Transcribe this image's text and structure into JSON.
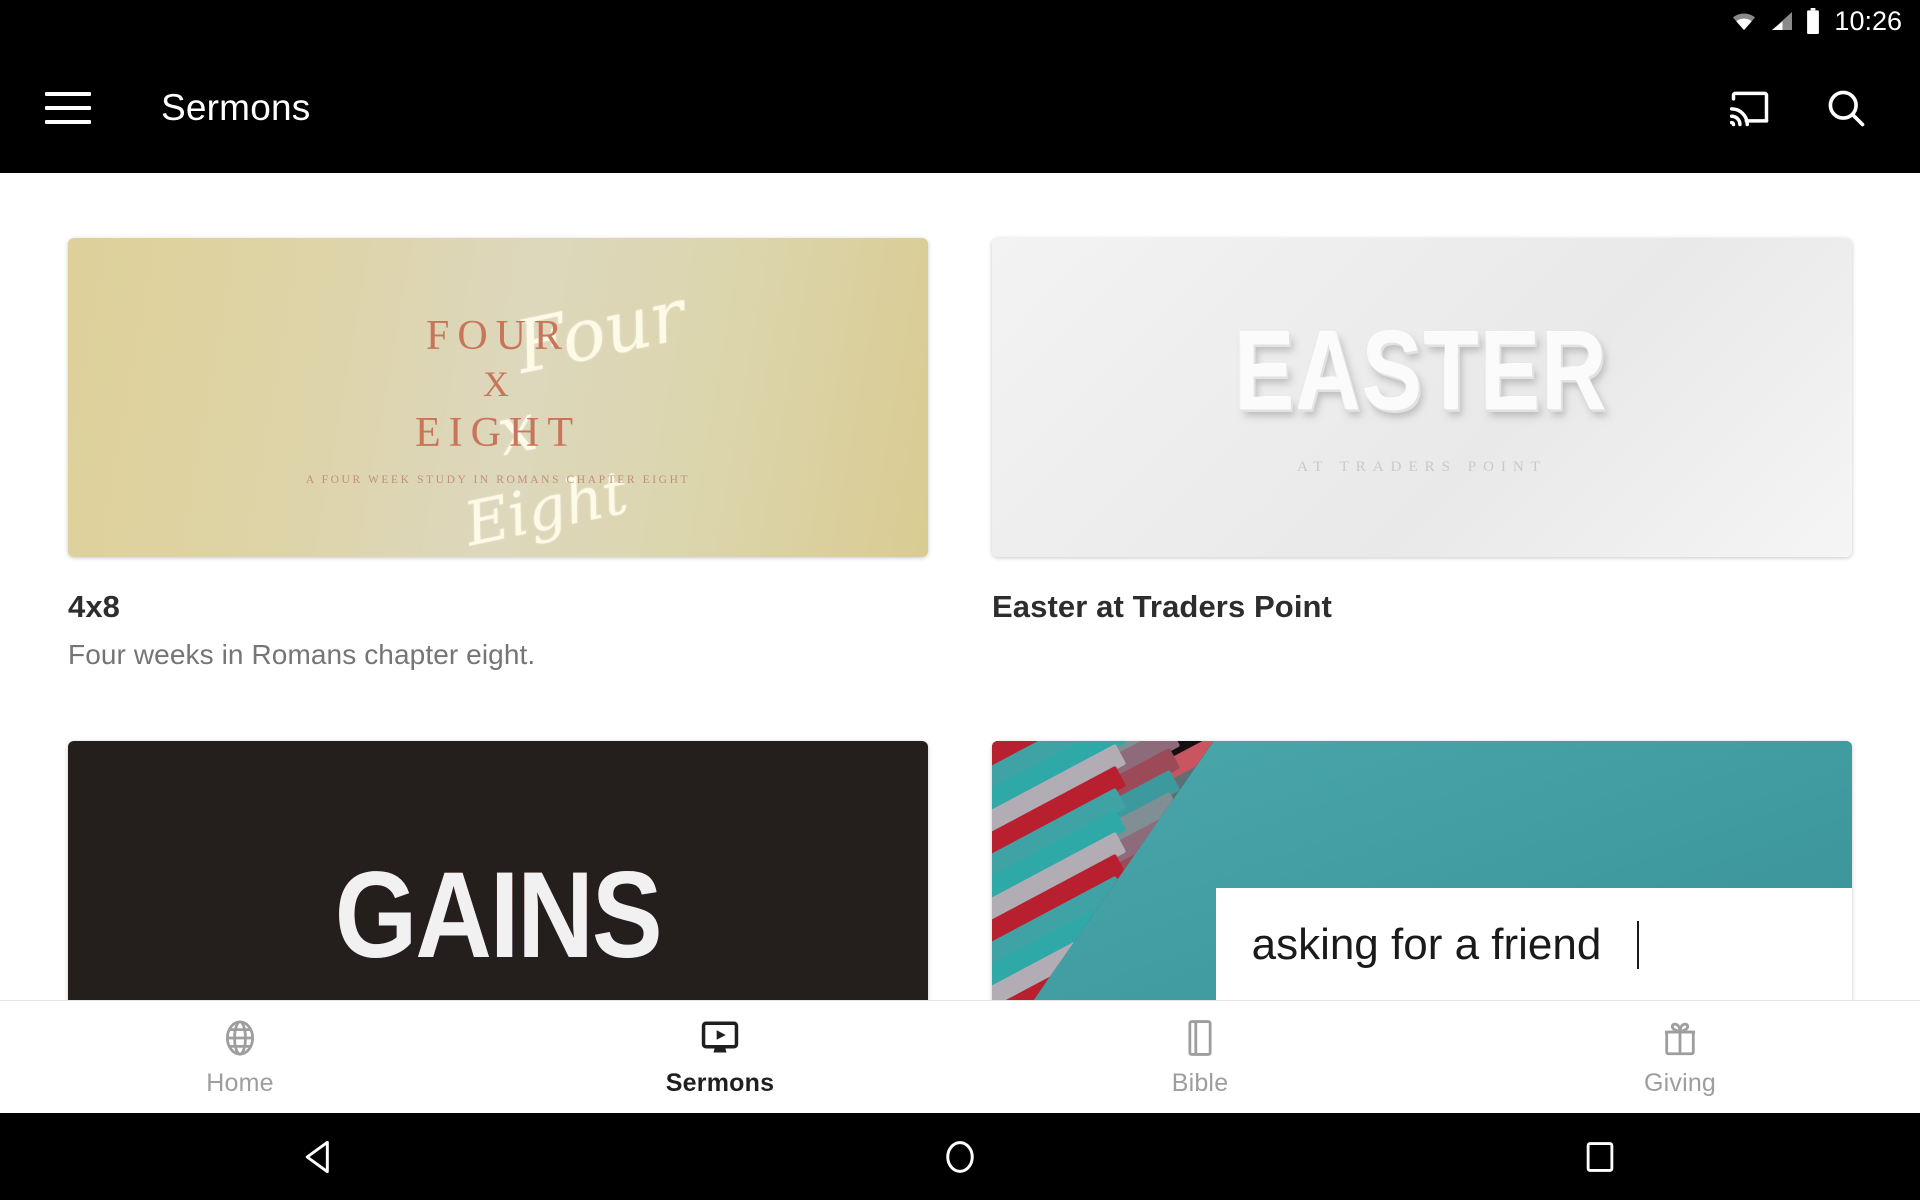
{
  "statusbar": {
    "time": "10:26",
    "icons": [
      "wifi-icon",
      "cellular-signal-icon",
      "battery-icon"
    ]
  },
  "appbar": {
    "menu_icon": "hamburger-menu-icon",
    "title": "Sermons",
    "cast_icon": "cast-icon",
    "search_icon": "search-icon"
  },
  "main": {
    "cards": [
      {
        "title": "4x8",
        "subtitle": "Four weeks in Romans chapter eight.",
        "artwork": {
          "kind": "four-x-eight",
          "line1": "FOUR",
          "line2": "X",
          "line3": "EIGHT",
          "tagline": "A FOUR WEEK STUDY IN ROMANS CHAPTER EIGHT",
          "script_overlay": [
            "Four",
            "x",
            "Eight"
          ],
          "bg_color": "#ddd09a",
          "text_color": "#c9755a"
        }
      },
      {
        "title": "Easter at Traders Point",
        "subtitle": "",
        "artwork": {
          "kind": "easter",
          "headline": "EASTER",
          "subline": "AT TRADERS POINT",
          "bg_color": "#ededed",
          "text_color": "#fbfbfb"
        }
      },
      {
        "title": "",
        "subtitle": "",
        "artwork": {
          "kind": "gains",
          "headline": "GAINS",
          "bg_color": "#241e1c",
          "text_color": "#f1f1f1",
          "gradient_colors": [
            "#ff5a1f",
            "#f03a22",
            "#c42f55",
            "#8e35a0",
            "#5840c6",
            "#3f52d6"
          ]
        }
      },
      {
        "title": "",
        "subtitle": "",
        "artwork": {
          "kind": "asking-for-a-friend",
          "headline": "asking for a friend",
          "bg_color": "#3f9ba0",
          "box_color": "#ffffff",
          "text_color": "#1a1a1a"
        }
      }
    ]
  },
  "bottomnav": {
    "items": [
      {
        "label": "Home",
        "icon": "globe-icon",
        "active": false
      },
      {
        "label": "Sermons",
        "icon": "tv-play-icon",
        "active": true
      },
      {
        "label": "Bible",
        "icon": "book-icon",
        "active": false
      },
      {
        "label": "Giving",
        "icon": "gift-icon",
        "active": false
      }
    ]
  },
  "sysnav": {
    "back": "back-triangle-icon",
    "home": "home-circle-icon",
    "recents": "recents-square-icon"
  }
}
